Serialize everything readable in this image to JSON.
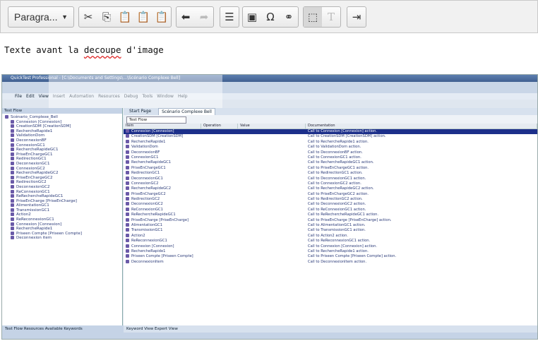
{
  "toolbar": {
    "paragraph_label": "Paragra...",
    "icons": [
      "cut-icon",
      "copy-icon",
      "paste-icon",
      "paste-text-icon",
      "paste-word-icon",
      "undo-icon",
      "redo-icon",
      "bullet-list-icon",
      "image-icon",
      "special-char-icon",
      "link-icon",
      "show-blocks-icon",
      "remove-format-icon",
      "indent-icon"
    ]
  },
  "editor": {
    "text_before": "Texte avant la ",
    "misspelled": "decoupe",
    "text_after": " d'image"
  },
  "screenshot": {
    "title": "QuickTest Professional - [C:\\Documents and Settings\\...\\Scénario Complexe Bell]",
    "menu": [
      "File",
      "Edit",
      "View",
      "Insert",
      "Automation",
      "Resources",
      "Debug",
      "Tools",
      "Window",
      "Help"
    ],
    "left_header": "Test Flow",
    "tree_root": "Scénario_Complexe_Bell",
    "tree_items": [
      "Connexion [Connexion]",
      "CreationSDM [CreationSDM]",
      "RechercheRapide1",
      "ValidationDom",
      "DeconnexionBF",
      "ConnexionGC1",
      "RechercheRapideGC1",
      "PriseEnChargeGC1",
      "RedirectionGC1",
      "DeconnexionGC1",
      "ConnexionGC2",
      "RechercheRapideGC2",
      "PriseEnChargeGC2",
      "RedirectionGC2",
      "DeconnexionGC2",
      "ReConnexionGC1",
      "ReRechercheRapideGC1",
      "PriseEnCharge [PriseEnCharge]",
      "AlimentationGC1",
      "TransmissionGC1",
      "Action2",
      "ReReconnexionGC1",
      "Connexion [Connexion]",
      "RechercheRapide1",
      "Priseen Compte [Priseen Compte]",
      "Deconnexion item"
    ],
    "left_footer": "Test Flow   Resources   Available Keywords",
    "tabs": [
      "Start Page",
      "Scénario Complexe Bell"
    ],
    "filter_label": "Test Flow",
    "columns": [
      "Item",
      "Operation",
      "Value",
      "Documentation"
    ],
    "rows": [
      [
        "Connexion [Connexion]",
        "Call to Connexion [Connexion] action."
      ],
      [
        "CreationSDM [CreationSDM]",
        "Call to CreationSDM [CreationSDM] action."
      ],
      [
        "RechercheRapide1",
        "Call to RechercheRapide1 action."
      ],
      [
        "ValidationDom",
        "Call to ValidationDom action."
      ],
      [
        "DeconnexionBF",
        "Call to DeconnexionBF action."
      ],
      [
        "ConnexionGC1",
        "Call to ConnexionGC1 action."
      ],
      [
        "RechercheRapideGC1",
        "Call to RechercheRapideGC1 action."
      ],
      [
        "PriseEnChargeGC1",
        "Call to PriseEnChargeGC1 action."
      ],
      [
        "RedirectionGC1",
        "Call to RedirectionGC1 action."
      ],
      [
        "DeconnexionGC1",
        "Call to DeconnexionGC1 action."
      ],
      [
        "ConnexionGC2",
        "Call to ConnexionGC2 action."
      ],
      [
        "RechercheRapideGC2",
        "Call to RechercheRapideGC2 action."
      ],
      [
        "PriseEnChargeGC2",
        "Call to PriseEnChargeGC2 action."
      ],
      [
        "RedirectionGC2",
        "Call to RedirectionGC2 action."
      ],
      [
        "DeconnexionGC2",
        "Call to DeconnexionGC2 action."
      ],
      [
        "ReConnexionGC1",
        "Call to ReConnexionGC1 action."
      ],
      [
        "ReRechercheRapideGC1",
        "Call to ReRechercheRapideGC1 action."
      ],
      [
        "PriseEnCharge [PriseEnCharge]",
        "Call to PriseEnCharge [PriseEnCharge] action."
      ],
      [
        "AlimentationGC1",
        "Call to AlimentationGC1 action."
      ],
      [
        "TransmissionGC1",
        "Call to TransmissionGC1 action."
      ],
      [
        "Action2",
        "Call to Action2 action."
      ],
      [
        "ReReconnexionGC1",
        "Call to ReReconnexionGC1 action."
      ],
      [
        "Connexion [Connexion]",
        "Call to Connexion [Connexion] action."
      ],
      [
        "RechercheRapide1",
        "Call to RechercheRapide1 action."
      ],
      [
        "Priseen Compte [Priseen Compte]",
        "Call to Priseen Compte [Priseen Compte] action."
      ],
      [
        "DeconnexionItem",
        "Call to DeconnexionItem action."
      ]
    ],
    "bottom_tabs": "Keyword View   Expert View"
  }
}
